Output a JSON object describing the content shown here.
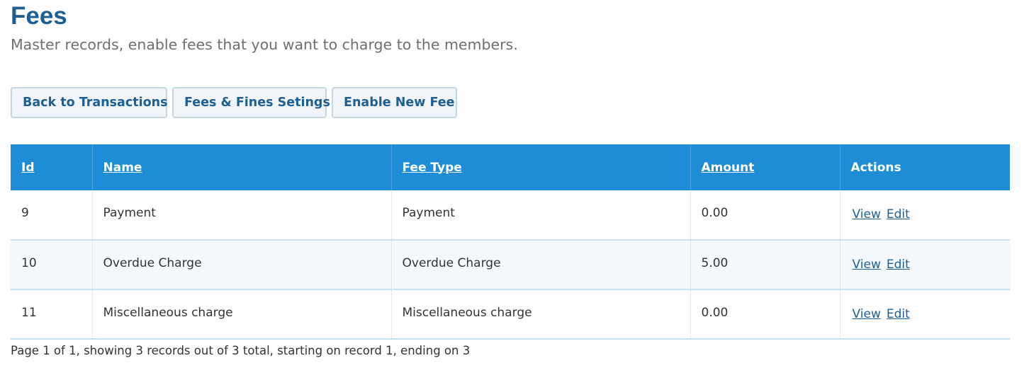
{
  "page": {
    "title": "Fees",
    "subtitle": "Master records, enable fees that you want to charge to the members."
  },
  "buttons": {
    "back": "Back to Transactions",
    "settings": "Fees & Fines Setings",
    "enable": "Enable New Fee"
  },
  "table": {
    "headers": {
      "id": "Id",
      "name": "Name",
      "fee_type": "Fee Type",
      "amount": "Amount",
      "actions": "Actions"
    },
    "rows": [
      {
        "id": "9",
        "name": "Payment",
        "fee_type": "Payment",
        "amount": "0.00",
        "view": "View",
        "edit": "Edit"
      },
      {
        "id": "10",
        "name": "Overdue Charge",
        "fee_type": "Overdue Charge",
        "amount": "5.00",
        "view": "View",
        "edit": "Edit"
      },
      {
        "id": "11",
        "name": "Miscellaneous charge",
        "fee_type": "Miscellaneous charge",
        "amount": "0.00",
        "view": "View",
        "edit": "Edit"
      }
    ]
  },
  "pager": {
    "summary": "Page 1 of 1, showing 3 records out of 3 total, starting on record 1, ending on 3"
  },
  "colors": {
    "title": "#1d5f93",
    "table_header": "#1f8dd6",
    "link": "#1d5f93"
  }
}
